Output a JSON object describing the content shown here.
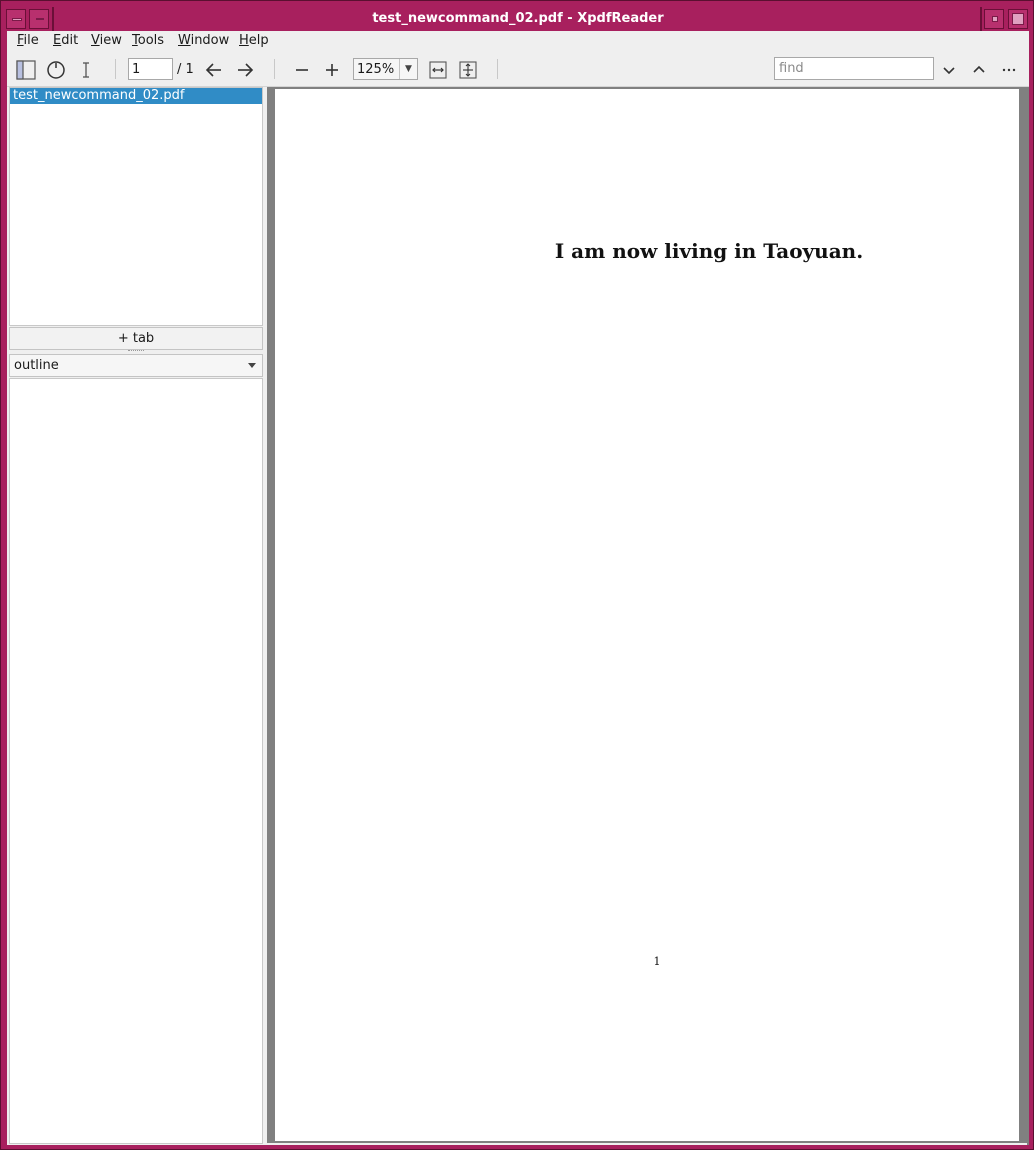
{
  "window": {
    "title": "test_newcommand_02.pdf - XpdfReader"
  },
  "menubar": {
    "items": [
      {
        "label": "File",
        "accel": "F",
        "rest": "ile"
      },
      {
        "label": "Edit",
        "accel": "E",
        "rest": "dit"
      },
      {
        "label": "View",
        "accel": "V",
        "rest": "iew"
      },
      {
        "label": "Tools",
        "accel": "T",
        "rest": "ools"
      },
      {
        "label": "Window",
        "accel": "W",
        "rest": "indow"
      },
      {
        "label": "Help",
        "accel": "H",
        "rest": "elp"
      }
    ]
  },
  "toolbar": {
    "icons": {
      "sidebar": "sidebar-toggle-icon",
      "pan": "pan-tool-icon",
      "select": "text-select-icon",
      "prev": "arrow-left-icon",
      "next": "arrow-right-icon",
      "zoom_out": "zoom-out-icon",
      "zoom_in": "zoom-in-icon",
      "fit_width": "fit-width-icon",
      "fit_page": "fit-page-icon",
      "find_next": "chevron-down-icon",
      "find_prev": "chevron-up-icon",
      "more": "more-icon"
    },
    "page_number": "1",
    "page_total": "/ 1",
    "zoom": "125%",
    "find_placeholder": "find"
  },
  "sidebar": {
    "tabs": [
      {
        "label": "test_newcommand_02.pdf",
        "selected": true
      }
    ],
    "add_tab_label": "+ tab",
    "panel_select": "outline"
  },
  "document": {
    "heading": "I am now living in Taoyuan.",
    "page_number_text": "1"
  },
  "colors": {
    "frame": "#a8205e",
    "selection": "#308cc6",
    "doc_background": "#808080"
  }
}
